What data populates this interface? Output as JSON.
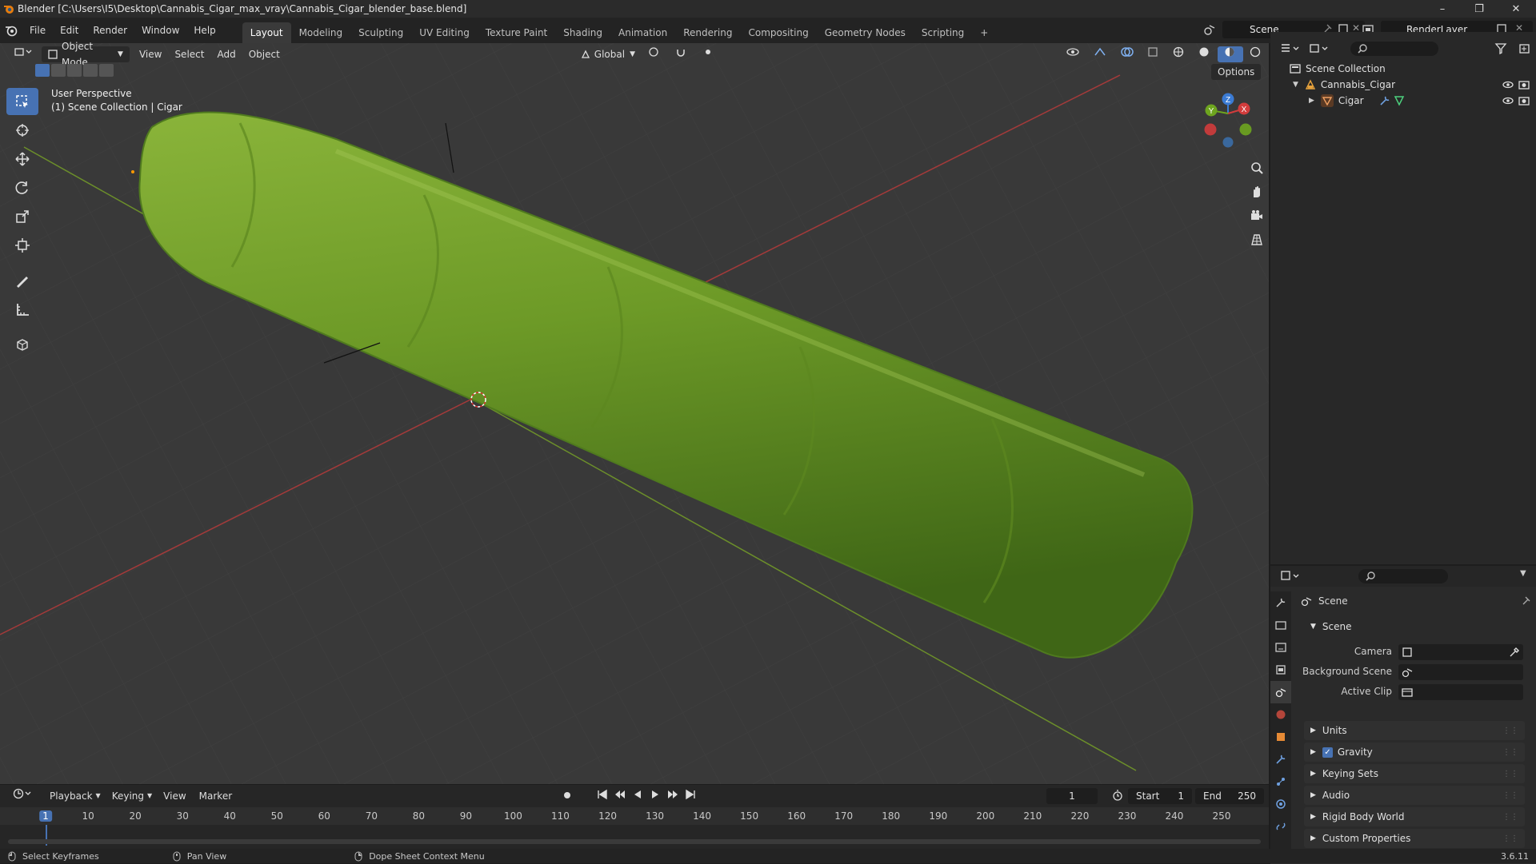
{
  "window": {
    "title": "Blender [C:\\Users\\I5\\Desktop\\Cannabis_Cigar_max_vray\\Cannabis_Cigar_blender_base.blend]",
    "minimize": "–",
    "maximize": "❐",
    "close": "✕"
  },
  "menus": [
    "File",
    "Edit",
    "Render",
    "Window",
    "Help"
  ],
  "workspaces": [
    "Layout",
    "Modeling",
    "Sculpting",
    "UV Editing",
    "Texture Paint",
    "Shading",
    "Animation",
    "Rendering",
    "Compositing",
    "Geometry Nodes",
    "Scripting",
    "+"
  ],
  "active_workspace": "Layout",
  "scene_name": "Scene",
  "render_layer": "RenderLayer",
  "viewport": {
    "mode": "Object Mode",
    "menus": [
      "View",
      "Select",
      "Add",
      "Object"
    ],
    "transform_orientation": "Global",
    "options_label": "Options",
    "overlay_line1": "User Perspective",
    "overlay_line2": "(1) Scene Collection | Cigar",
    "gizmo_labels": {
      "z": "Z",
      "y": "Y",
      "x": "X"
    },
    "cigar_color": "#6f9a2a",
    "icons": [
      "select-box-icon",
      "cursor-icon",
      "move-icon",
      "rotate-icon",
      "scale-icon",
      "transform-icon",
      "annotate-icon",
      "measure-icon",
      "add-cube-icon"
    ]
  },
  "outliner": {
    "root": "Scene Collection",
    "items": [
      {
        "name": "Cannabis_Cigar",
        "type": "collection"
      },
      {
        "name": "Cigar",
        "type": "mesh"
      }
    ]
  },
  "properties": {
    "context": "Scene",
    "panel_title": "Scene",
    "fields": [
      {
        "label": "Camera",
        "value": ""
      },
      {
        "label": "Background Scene",
        "value": ""
      },
      {
        "label": "Active Clip",
        "value": ""
      }
    ],
    "sections": [
      "Units",
      "Gravity",
      "Keying Sets",
      "Audio",
      "Rigid Body World",
      "Custom Properties"
    ],
    "gravity_checked": true
  },
  "timeline": {
    "menus": [
      "Playback",
      "Keying",
      "View",
      "Marker"
    ],
    "current_frame": "1",
    "start_label": "Start",
    "start": "1",
    "end_label": "End",
    "end": "250",
    "ticks": [
      "1",
      "10",
      "20",
      "30",
      "40",
      "50",
      "60",
      "70",
      "80",
      "90",
      "100",
      "110",
      "120",
      "130",
      "140",
      "150",
      "160",
      "170",
      "180",
      "190",
      "200",
      "210",
      "220",
      "230",
      "240",
      "250"
    ]
  },
  "status": {
    "left": "Select Keyframes",
    "middle": "Pan View",
    "right": "Dope Sheet Context Menu",
    "version": "3.6.11"
  }
}
